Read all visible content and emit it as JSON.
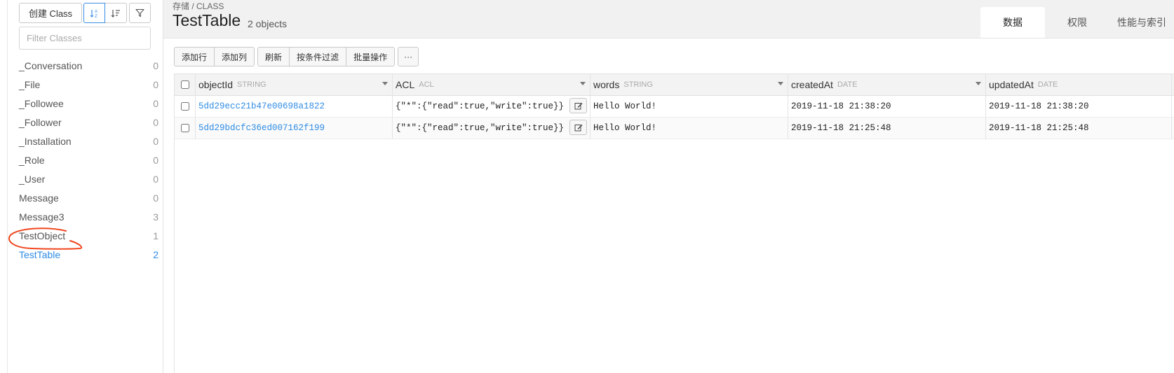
{
  "sidebar": {
    "create_label": "创建 Class",
    "filter_placeholder": "Filter Classes",
    "classes": [
      {
        "name": "_Conversation",
        "count": "0"
      },
      {
        "name": "_File",
        "count": "0"
      },
      {
        "name": "_Followee",
        "count": "0"
      },
      {
        "name": "_Follower",
        "count": "0"
      },
      {
        "name": "_Installation",
        "count": "0"
      },
      {
        "name": "_Role",
        "count": "0"
      },
      {
        "name": "_User",
        "count": "0"
      },
      {
        "name": "Message",
        "count": "0"
      },
      {
        "name": "Message3",
        "count": "3"
      },
      {
        "name": "TestObject",
        "count": "1"
      },
      {
        "name": "TestTable",
        "count": "2"
      }
    ],
    "active_class": "TestTable",
    "accent_color": "#2f8ce4",
    "annotation_color": "#f0461e"
  },
  "header": {
    "breadcrumb": "存储 / CLASS",
    "title": "TestTable",
    "object_count": "2 objects",
    "tabs": [
      {
        "label": "数据",
        "active": true
      },
      {
        "label": "权限",
        "active": false
      },
      {
        "label": "性能与索引",
        "active": false
      }
    ]
  },
  "toolbar": {
    "add_row": "添加行",
    "add_column": "添加列",
    "refresh": "刷新",
    "filter": "按条件过滤",
    "batch": "批量操作",
    "more": "···"
  },
  "table": {
    "columns": [
      {
        "name": "objectId",
        "type": "STRING"
      },
      {
        "name": "ACL",
        "type": "ACL"
      },
      {
        "name": "words",
        "type": "STRING"
      },
      {
        "name": "createdAt",
        "type": "DATE"
      },
      {
        "name": "updatedAt",
        "type": "DATE"
      }
    ],
    "rows": [
      {
        "objectId": "5dd29ecc21b47e00698a1822",
        "acl": "{\"*\":{\"read\":true,\"write\":true}}",
        "words": "Hello World!",
        "createdAt": "2019-11-18 21:38:20",
        "updatedAt": "2019-11-18 21:38:20"
      },
      {
        "objectId": "5dd29bdcfc36ed007162f199",
        "acl": "{\"*\":{\"read\":true,\"write\":true}}",
        "words": "Hello World!",
        "createdAt": "2019-11-18 21:25:48",
        "updatedAt": "2019-11-18 21:25:48"
      }
    ]
  }
}
